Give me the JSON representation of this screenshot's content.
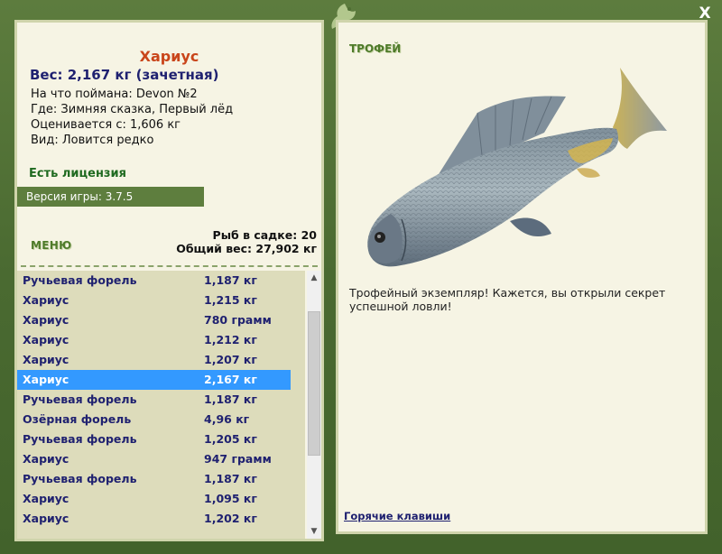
{
  "window": {
    "close_label": "X"
  },
  "catch": {
    "title": "Хариус",
    "weight_line": "Вес: 2,167 кг (зачетная)",
    "info": [
      "На что поймана: Devon №2",
      "Где: Зимняя сказка, Первый лёд",
      "Оценивается с: 1,606 кг",
      "Вид: Ловится редко"
    ],
    "license": "Есть лицензия",
    "version": "Версия игры: 3.7.5"
  },
  "menu": {
    "label": "МЕНЮ"
  },
  "stats": {
    "fish_count": "Рыб в садке: 20",
    "total_weight": "Общий вес: 27,902 кг"
  },
  "fish_list": [
    {
      "name": "Ручьевая форель",
      "weight": "1,187 кг"
    },
    {
      "name": "Хариус",
      "weight": "1,215 кг"
    },
    {
      "name": "Хариус",
      "weight": "780 грамм"
    },
    {
      "name": "Хариус",
      "weight": "1,212 кг"
    },
    {
      "name": "Хариус",
      "weight": "1,207 кг"
    },
    {
      "name": "Хариус",
      "weight": "2,167 кг",
      "selected": true
    },
    {
      "name": "Ручьевая форель",
      "weight": "1,187 кг"
    },
    {
      "name": "Озёрная форель",
      "weight": "4,96 кг"
    },
    {
      "name": "Ручьевая форель",
      "weight": "1,205 кг"
    },
    {
      "name": "Хариус",
      "weight": "947 грамм"
    },
    {
      "name": "Ручьевая форель",
      "weight": "1,187 кг"
    },
    {
      "name": "Хариус",
      "weight": "1,095 кг"
    },
    {
      "name": "Хариус",
      "weight": "1,202 кг"
    }
  ],
  "trophy": {
    "label": "ТРОФЕЙ",
    "text": "Трофейный экземпляр! Кажется, вы открыли секрет успешной ловли!",
    "hotkeys": "Горячие клавиши"
  },
  "colors": {
    "frame": "#4f6e34",
    "panel": "#f6f4e4",
    "list_bg": "#dddcbb",
    "selection": "#3399ff",
    "title": "#c9451a",
    "navy": "#1f2170",
    "license_green": "#1f6a20"
  },
  "icons": [
    "close-icon",
    "lizard-logo-icon",
    "scroll-up-icon",
    "scroll-down-icon"
  ]
}
